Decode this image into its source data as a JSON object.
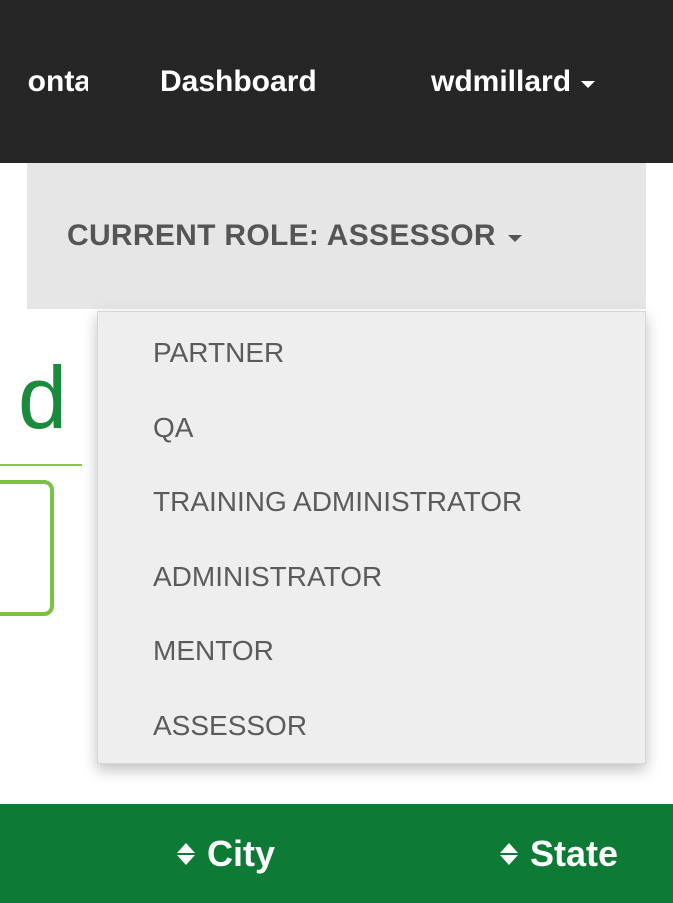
{
  "navbar": {
    "contact_label": "Contact Us",
    "dashboard_label": "Dashboard",
    "user_label": "wdmillard"
  },
  "role_selector": {
    "label": "CURRENT ROLE: ASSESSOR"
  },
  "page": {
    "heading_partial": "d"
  },
  "role_menu": {
    "items": [
      {
        "label": "PARTNER"
      },
      {
        "label": "QA"
      },
      {
        "label": "TRAINING ADMINISTRATOR"
      },
      {
        "label": "ADMINISTRATOR"
      },
      {
        "label": "MENTOR"
      },
      {
        "label": "ASSESSOR"
      }
    ]
  },
  "table": {
    "columns": [
      {
        "label": "City"
      },
      {
        "label": "State"
      }
    ]
  },
  "colors": {
    "navbar_bg": "#262626",
    "role_bg": "#e6e6e6",
    "brand_green": "#0d7a35",
    "heading_green": "#1a8a3c",
    "accent_green": "#7cc242"
  },
  "icons": {
    "nav_caret": "caret-down-icon",
    "sort": "sort-icon"
  }
}
